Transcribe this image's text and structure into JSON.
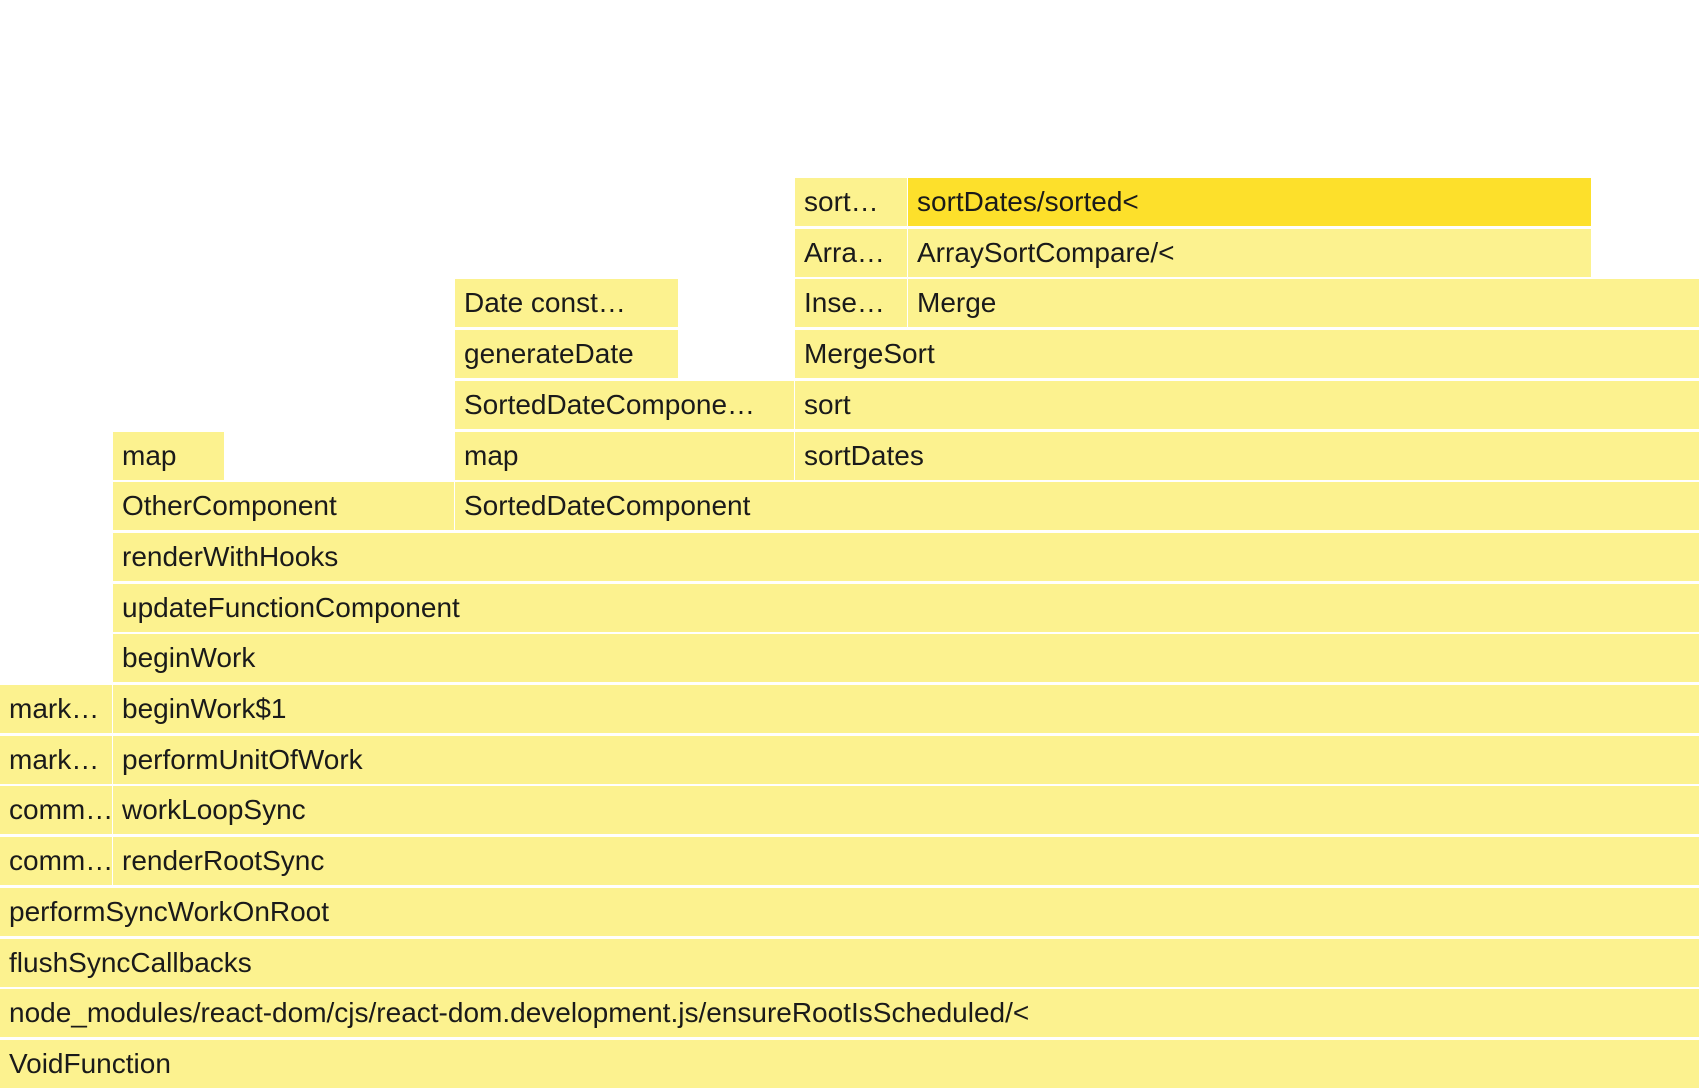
{
  "flamegraph": {
    "colors": {
      "frame": "#fcf28f",
      "selected": "#fde02b",
      "text": "#1a1a1a"
    },
    "frames": [
      {
        "label": "sort…",
        "name": "frame-sort-ellipsis"
      },
      {
        "label": "sortDates/sorted<",
        "name": "frame-sortdates-sorted",
        "selected": true
      },
      {
        "label": "Arra…",
        "name": "frame-arra-ellipsis"
      },
      {
        "label": "ArraySortCompare/<",
        "name": "frame-arraysortcompare"
      },
      {
        "label": "Date const…",
        "name": "frame-date-constructor"
      },
      {
        "label": "Inse…",
        "name": "frame-inse-ellipsis"
      },
      {
        "label": "Merge",
        "name": "frame-merge"
      },
      {
        "label": "generateDate",
        "name": "frame-generatedate"
      },
      {
        "label": "MergeSort",
        "name": "frame-mergesort"
      },
      {
        "label": "SortedDateCompone…",
        "name": "frame-sorteddatecomponent-truncated"
      },
      {
        "label": "sort",
        "name": "frame-sort"
      },
      {
        "label": "map",
        "name": "frame-map-other"
      },
      {
        "label": "map",
        "name": "frame-map-sorted"
      },
      {
        "label": "sortDates",
        "name": "frame-sortdates"
      },
      {
        "label": "OtherComponent",
        "name": "frame-othercomponent"
      },
      {
        "label": "SortedDateComponent",
        "name": "frame-sorteddatecomponent"
      },
      {
        "label": "renderWithHooks",
        "name": "frame-renderwithhooks"
      },
      {
        "label": "updateFunctionComponent",
        "name": "frame-updatefunctioncomponent"
      },
      {
        "label": "beginWork",
        "name": "frame-beginwork"
      },
      {
        "label": "mark…",
        "name": "frame-mark-1"
      },
      {
        "label": "beginWork$1",
        "name": "frame-beginwork-1"
      },
      {
        "label": "mark…",
        "name": "frame-mark-2"
      },
      {
        "label": "performUnitOfWork",
        "name": "frame-performunitofwork"
      },
      {
        "label": "comm…",
        "name": "frame-comm-1"
      },
      {
        "label": "workLoopSync",
        "name": "frame-workloopsync"
      },
      {
        "label": "comm…",
        "name": "frame-comm-2"
      },
      {
        "label": "renderRootSync",
        "name": "frame-renderrootsync"
      },
      {
        "label": "performSyncWorkOnRoot",
        "name": "frame-performsyncworkonroot"
      },
      {
        "label": "flushSyncCallbacks",
        "name": "frame-flushsynccallbacks"
      },
      {
        "label": "node_modules/react-dom/cjs/react-dom.development.js/ensureRootIsScheduled/<",
        "name": "frame-ensurerootisscheduled"
      },
      {
        "label": "VoidFunction",
        "name": "frame-voidfunction"
      }
    ]
  }
}
